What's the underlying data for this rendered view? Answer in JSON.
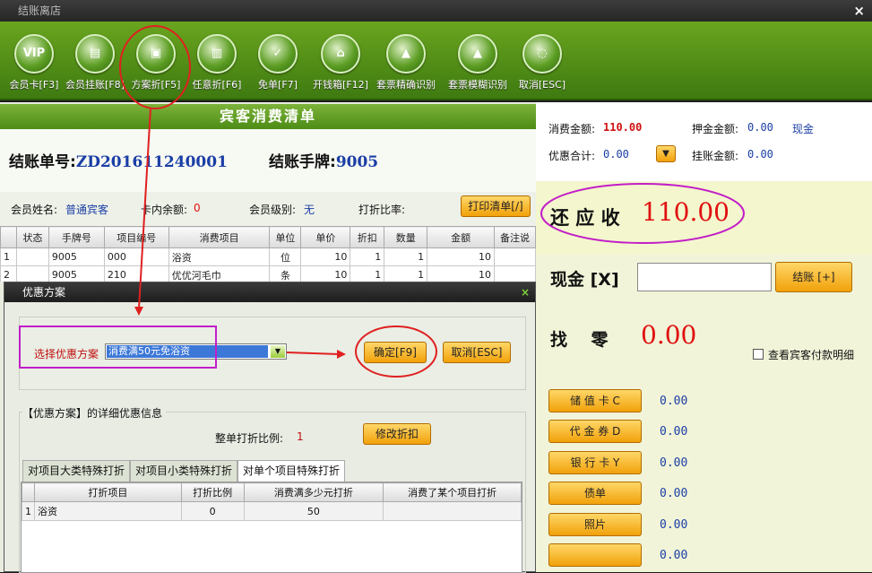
{
  "window": {
    "title": "结账离店"
  },
  "toolbar": [
    {
      "label": "会员卡[F3]",
      "icon": "vip-icon",
      "glyph": "VIP"
    },
    {
      "label": "会员挂账[F8]",
      "icon": "ledger-icon",
      "glyph": "▤"
    },
    {
      "label": "方案折[F5]",
      "icon": "window-icon",
      "glyph": "▣"
    },
    {
      "label": "任意折[F6]",
      "icon": "towel-icon",
      "glyph": "▥"
    },
    {
      "label": "免单[F7]",
      "icon": "bag-icon",
      "glyph": "✓"
    },
    {
      "label": "开钱箱[F12]",
      "icon": "cashbox-icon",
      "glyph": "⌂"
    },
    {
      "label": "套票精确识别",
      "icon": "triangle-icon",
      "glyph": "▲"
    },
    {
      "label": "套票模糊识别",
      "icon": "dual-triangle-icon",
      "glyph": "▲"
    },
    {
      "label": "取消[ESC]",
      "icon": "spinner-icon",
      "glyph": "◌"
    }
  ],
  "bill": {
    "header": "宾客消费清单",
    "bill_no_label": "结账单号:",
    "bill_no": "ZD201611240001",
    "hand_label": "结账手牌:",
    "hand_no": "9005",
    "member_name_label": "会员姓名:",
    "member_name": "普通宾客",
    "card_balance_label": "卡内余额:",
    "card_balance": "0",
    "member_level_label": "会员级别:",
    "member_level": "无",
    "discount_rate_label": "打折比率:",
    "print_button": "打印清单[/]",
    "columns": [
      "",
      "状态",
      "手牌号",
      "项目编号",
      "消费项目",
      "单位",
      "单价",
      "折扣",
      "数量",
      "金额",
      "备注说"
    ],
    "rows": [
      [
        "1",
        "",
        "9005",
        "000",
        "浴资",
        "位",
        "10",
        "1",
        "1",
        "10",
        ""
      ],
      [
        "2",
        "",
        "9005",
        "210",
        "优优河毛巾",
        "条",
        "10",
        "1",
        "1",
        "10",
        ""
      ]
    ]
  },
  "summary": {
    "consume_label": "消费金额:",
    "consume": "110.00",
    "deposit_label": "押金金额:",
    "deposit": "0.00",
    "deposit_type": "现金",
    "discount_total_label": "优惠合计:",
    "discount_total": "0.00",
    "credit_label": "挂账金额:",
    "credit": "0.00"
  },
  "due": {
    "label": "还 应 收",
    "amount": "110.00"
  },
  "cash": {
    "label": "现金 [X]",
    "value": "",
    "checkout_button": "结账 [+]"
  },
  "change": {
    "label": "找    零",
    "amount": "0.00",
    "detail_checkbox": "查看宾客付款明细"
  },
  "payments": [
    {
      "label": "储 值 卡 C",
      "value": "0.00"
    },
    {
      "label": "代 金 券 D",
      "value": "0.00"
    },
    {
      "label": "银 行 卡 Y",
      "value": "0.00"
    },
    {
      "label": "债单",
      "value": "0.00"
    },
    {
      "label": "照片",
      "value": "0.00"
    },
    {
      "label": "",
      "value": "0.00"
    }
  ],
  "dialog": {
    "title": "优惠方案",
    "select_label": "选择优惠方案",
    "selected_plan": "消费满50元免浴资",
    "confirm_button": "确定[F9]",
    "cancel_button": "取消[ESC]",
    "detail_title": "【优惠方案】的详细优惠信息",
    "ratio_label": "整单打折比例:",
    "ratio": "1",
    "modify_button": "修改折扣",
    "tabs": [
      "对项目大类特殊打折",
      "对项目小类特殊打折",
      "对单个项目特殊打折"
    ],
    "columns": [
      "",
      "打折项目",
      "打折比例",
      "消费满多少元打折",
      "消费了某个项目打折"
    ],
    "rows": [
      [
        "1",
        "浴资",
        "0",
        "50",
        ""
      ]
    ]
  },
  "colors": {
    "accent_green": "#5a9a1c",
    "highlight_magenta": "#c21ec8",
    "annotation_red": "#e02020",
    "amount_red": "#e01010",
    "value_blue": "#1a3ea6"
  }
}
